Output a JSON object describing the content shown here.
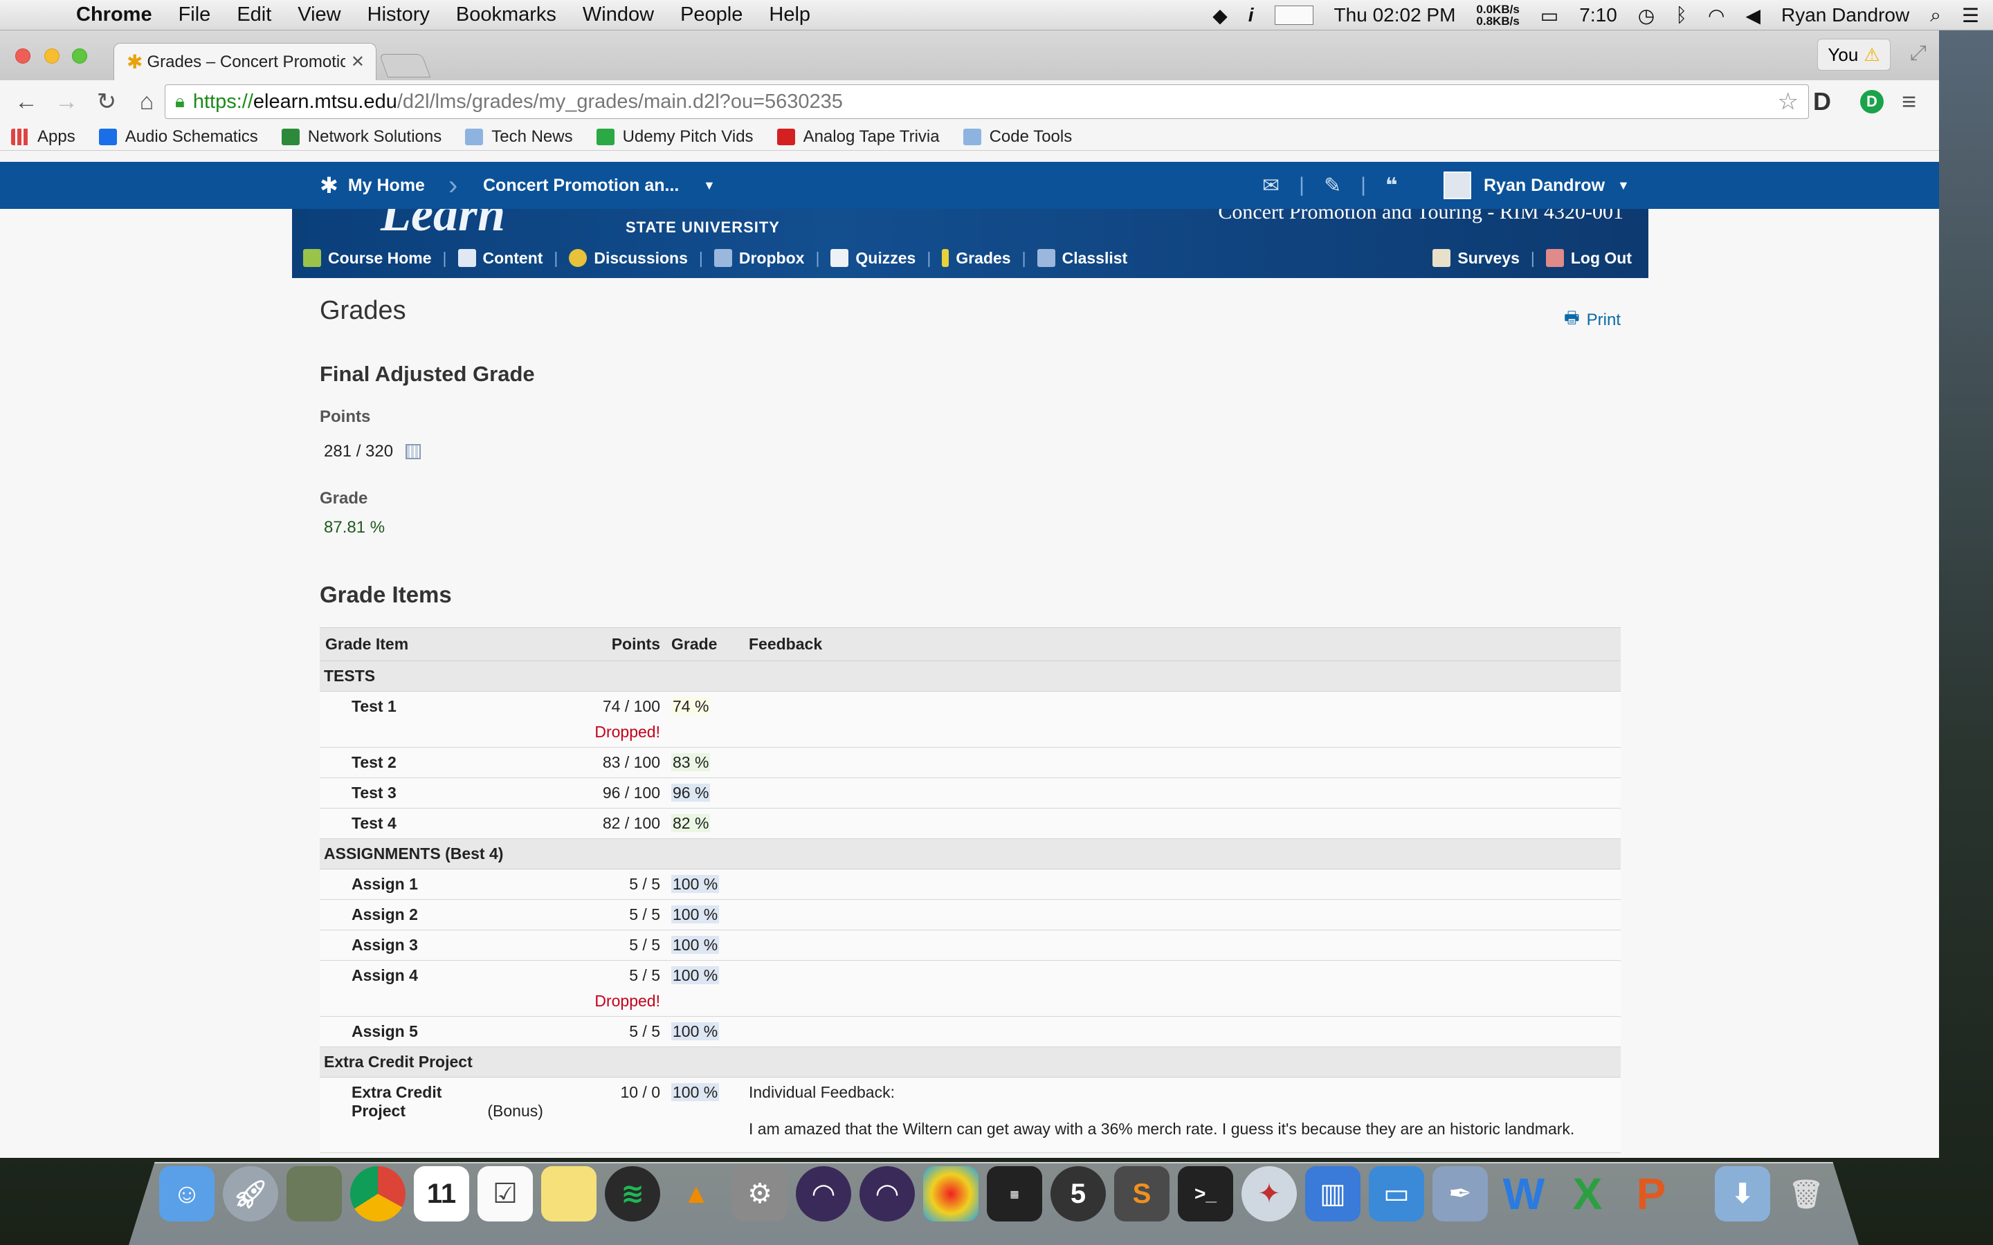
{
  "menubar": {
    "app_name": "Chrome",
    "menus": [
      "File",
      "Edit",
      "View",
      "History",
      "Bookmarks",
      "Window",
      "People",
      "Help"
    ],
    "clock": "Thu 02:02 PM",
    "net_up": "0.0KB/s",
    "net_down": "0.8KB/s",
    "battery_time": "7:10",
    "user_name": "Ryan Dandrow"
  },
  "browser": {
    "tab_title": "Grades – Concert Promotio",
    "profile_label": "You",
    "url_scheme": "https://",
    "url_host": "elearn.mtsu.edu",
    "url_path": "/d2l/lms/grades/my_grades/main.d2l?ou=5630235",
    "bookmarks": [
      "Apps",
      "Audio Schematics",
      "Network Solutions",
      "Tech News",
      "Udemy Pitch Vids",
      "Analog Tape Trivia",
      "Code Tools"
    ]
  },
  "minibar": {
    "home_label": "My Home",
    "course_label": "Concert Promotion an...",
    "user_label": "Ryan Dandrow"
  },
  "banner": {
    "logo_text": "Learn",
    "university": "STATE UNIVERSITY",
    "course_title": "Concert Promotion and Touring - RIM 4320-001"
  },
  "navbar": {
    "items": [
      "Course Home",
      "Content",
      "Discussions",
      "Dropbox",
      "Quizzes",
      "Grades",
      "Classlist"
    ],
    "right_items": [
      "Surveys",
      "Log Out"
    ]
  },
  "content": {
    "title": "Grades",
    "print_label": "Print",
    "final_heading": "Final Adjusted Grade",
    "points_label": "Points",
    "points_value": "281 / 320",
    "grade_label": "Grade",
    "grade_value": "87.81 %",
    "items_heading": "Grade Items"
  },
  "table": {
    "headers": [
      "Grade Item",
      "Points",
      "Grade",
      "Feedback"
    ],
    "categories": [
      {
        "name": "TESTS"
      },
      {
        "name": "ASSIGNMENTS (Best 4)"
      },
      {
        "name": "Extra Credit Project"
      }
    ],
    "rows": [
      {
        "name": "Test 1",
        "points": "74 / 100",
        "grade": "74 %",
        "dropped": "Dropped!"
      },
      {
        "name": "Test 2",
        "points": "83 / 100",
        "grade": "83 %"
      },
      {
        "name": "Test 3",
        "points": "96 / 100",
        "grade": "96 %"
      },
      {
        "name": "Test 4",
        "points": "82 / 100",
        "grade": "82 %"
      },
      {
        "name": "Assign 1",
        "points": "5 / 5",
        "grade": "100 %"
      },
      {
        "name": "Assign 2",
        "points": "5 / 5",
        "grade": "100 %"
      },
      {
        "name": "Assign 3",
        "points": "5 / 5",
        "grade": "100 %"
      },
      {
        "name": "Assign 4",
        "points": "5 / 5",
        "grade": "100 %",
        "dropped": "Dropped!"
      },
      {
        "name": "Assign 5",
        "points": "5 / 5",
        "grade": "100 %"
      },
      {
        "name": "Extra Credit Project",
        "bonus": "(Bonus)",
        "points": "10 / 0",
        "grade": "100 %",
        "feedback_label": "Individual Feedback:",
        "feedback_text": "I am amazed that the Wiltern can get away with a 36% merch rate.  I guess it's because they are an historic landmark."
      }
    ]
  },
  "colors": {
    "d2l_blue": "#0b5299",
    "dropped_red": "#c4001a",
    "grade_green": "#1f5a1f"
  }
}
